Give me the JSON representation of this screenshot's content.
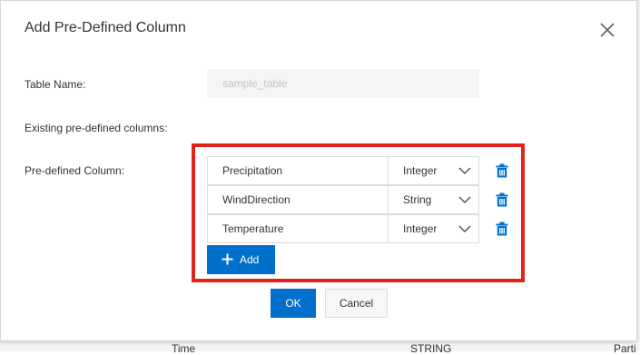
{
  "background": {
    "visible_text": [
      "Time",
      "STRING",
      "Parti"
    ]
  },
  "dialog": {
    "title": "Add Pre-Defined Column",
    "close_icon": "close-icon"
  },
  "form": {
    "table_name_label": "Table Name:",
    "table_name_value": "sample_table",
    "existing_label": "Existing pre-defined columns:",
    "predefined_label": "Pre-defined Column:",
    "columns": [
      {
        "name": "Precipitation",
        "type": "Integer"
      },
      {
        "name": "WindDirection",
        "type": "String"
      },
      {
        "name": "Temperature",
        "type": "Integer"
      }
    ],
    "add_label": "Add"
  },
  "footer": {
    "ok_label": "OK",
    "cancel_label": "Cancel"
  },
  "colors": {
    "primary": "#0070cc",
    "highlight": "#e2231a",
    "delete_icon": "#0070cc"
  }
}
